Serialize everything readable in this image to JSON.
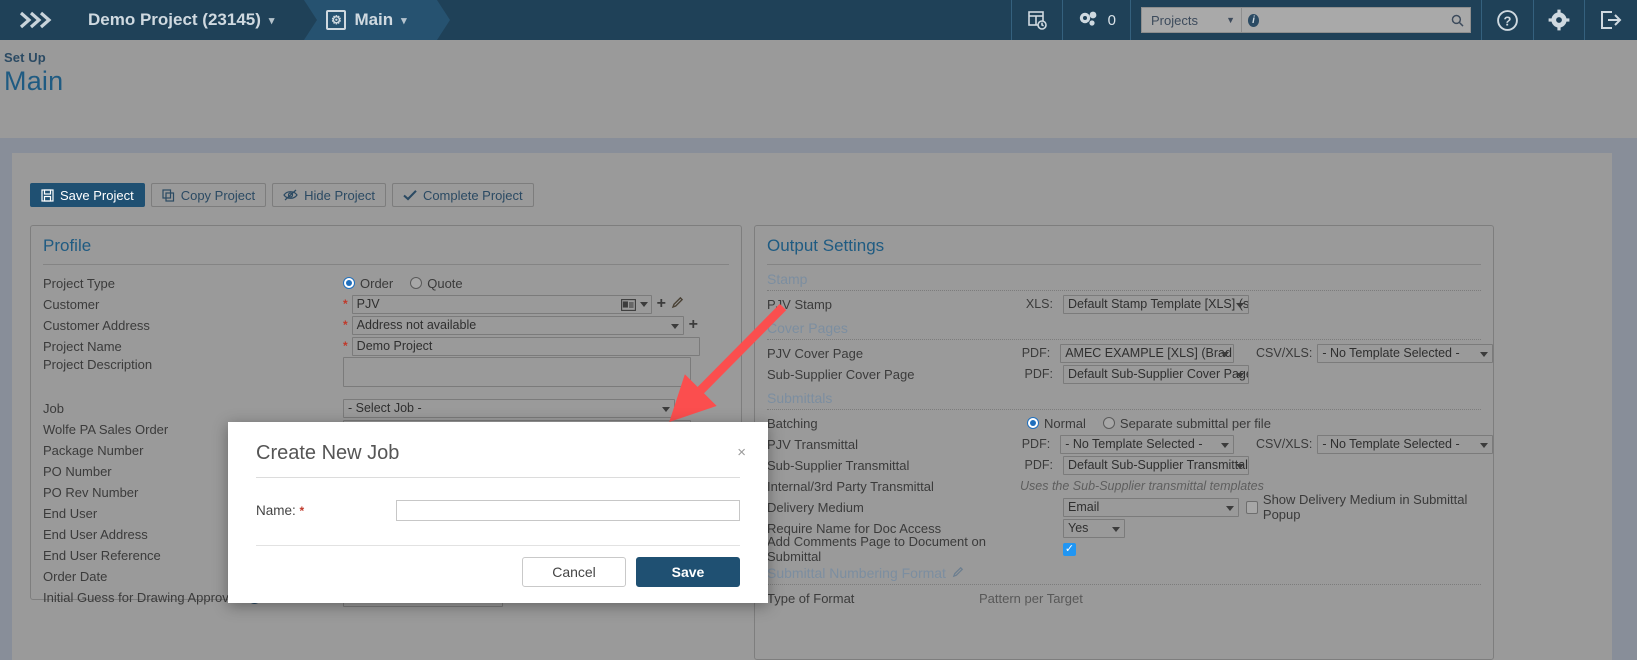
{
  "topnav": {
    "logo_icon": "chevrons-right-icon",
    "project_crumb": "Demo Project (23145)",
    "section_crumb": "Main",
    "section_icon": "gear-square-icon",
    "caret": "⌄",
    "schedule_icon": "calendar-report-icon",
    "settings_gear_icon": "gears-icon",
    "gears_count": "0",
    "search_scope": "Projects",
    "search_value": "",
    "search_placeholder": "",
    "search_info_icon": "info-circle-icon",
    "search_icon": "magnifier-icon",
    "help_icon": "question-circle-icon",
    "gear_icon": "gear-icon",
    "logout_icon": "logout-icon"
  },
  "pagehead": {
    "eyebrow": "Set Up",
    "title": "Main"
  },
  "toolbar": {
    "save_project": "Save Project",
    "save_icon": "floppy-disk-icon",
    "copy_project": "Copy Project",
    "copy_icon": "copy-icon",
    "hide_project": "Hide Project",
    "hide_icon": "eye-slash-icon",
    "complete_project": "Complete Project",
    "complete_icon": "check-icon"
  },
  "profile": {
    "title": "Profile",
    "project_type": {
      "label": "Project Type",
      "order": "Order",
      "quote": "Quote",
      "selected": "Order"
    },
    "customer": {
      "label": "Customer",
      "value": "PJV",
      "required": "*",
      "card_icon": "contact-card-icon",
      "add_icon": "plus-icon",
      "edit_icon": "pencil-icon"
    },
    "customer_address": {
      "label": "Customer Address",
      "value": "Address not available",
      "required": "*",
      "add_icon": "plus-icon"
    },
    "project_name": {
      "label": "Project Name",
      "value": "Demo Project",
      "required": "*"
    },
    "project_description": {
      "label": "Project Description",
      "value": ""
    },
    "job": {
      "label": "Job",
      "value": "- Select Job -",
      "add_icon": "plus-icon"
    },
    "wolfe_pa_sales_order": {
      "label": "Wolfe PA Sales Order",
      "value": ""
    },
    "package_number": {
      "label": "Package Number",
      "value": ""
    },
    "po_number": {
      "label": "PO Number",
      "value": ""
    },
    "po_rev_number": {
      "label": "PO Rev Number",
      "value": ""
    },
    "end_user": {
      "label": "End User",
      "value": ""
    },
    "end_user_address": {
      "label": "End User Address",
      "value": ""
    },
    "end_user_reference": {
      "label": "End User Reference",
      "value": ""
    },
    "order_date": {
      "label": "Order Date",
      "value": ""
    },
    "initial_guess": {
      "label": "Initial Guess for Drawing Approvals",
      "info_icon": "info-circle-icon",
      "value": ""
    }
  },
  "output": {
    "title": "Output Settings",
    "stamp_section": "Stamp",
    "pjv_stamp": {
      "label": "PJV Stamp",
      "kind": "XLS:",
      "value": "Default Stamp Template [XLS] (sy"
    },
    "cover_section": "Cover Pages",
    "pjv_cover": {
      "label": "PJV Cover Page",
      "kind": "PDF:",
      "value": "AMEC EXAMPLE [XLS] (Brad Bov",
      "alt_kind": "CSV/XLS:",
      "alt_value": "- No Template Selected -"
    },
    "sub_cover": {
      "label": "Sub-Supplier Cover Page",
      "kind": "PDF:",
      "value": "Default Sub-Supplier Cover Page"
    },
    "submittals_section": "Submittals",
    "batching": {
      "label": "Batching",
      "normal": "Normal",
      "separate": "Separate submittal per file",
      "selected": "Normal"
    },
    "pjv_transmittal": {
      "label": "PJV Transmittal",
      "kind": "PDF:",
      "value": "- No Template Selected -",
      "alt_kind": "CSV/XLS:",
      "alt_value": "- No Template Selected -"
    },
    "sub_transmittal": {
      "label": "Sub-Supplier Transmittal",
      "kind": "PDF:",
      "value": "Default Sub-Supplier Transmittal"
    },
    "internal_transmittal": {
      "label": "Internal/3rd Party Transmittal",
      "note": "Uses the Sub-Supplier transmittal templates"
    },
    "delivery_medium": {
      "label": "Delivery Medium",
      "value": "Email",
      "checkbox_label": "Show Delivery Medium in Submittal Popup",
      "checked": false
    },
    "require_name": {
      "label": "Require Name for Doc Access",
      "value": "Yes"
    },
    "add_comments": {
      "label": "Add Comments Page to Document on Submittal",
      "checked": true,
      "check_glyph": "✓"
    },
    "numbering_section": "Submittal Numbering Format",
    "numbering_edit_icon": "pencil-icon",
    "type_of_format": {
      "label": "Type of Format",
      "value": "Pattern per Target"
    }
  },
  "modal": {
    "title": "Create New Job",
    "close_icon": "close-icon",
    "close_glyph": "×",
    "name_label": "Name:",
    "name_required": "*",
    "name_value": "",
    "name_placeholder": "",
    "cancel": "Cancel",
    "save": "Save"
  },
  "annotation": {
    "arrow_icon": "red-arrow-pointer",
    "color": "#fb4e4e"
  }
}
